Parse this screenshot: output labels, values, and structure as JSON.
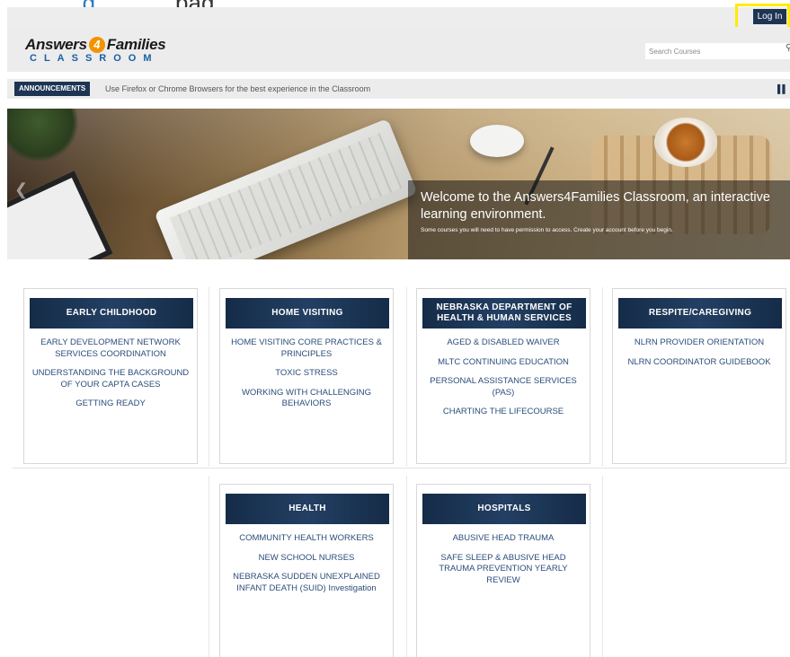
{
  "top_fragment": {
    "part1": "...g",
    "part2": "...pag"
  },
  "topbar": {
    "login_label": "Log In"
  },
  "header": {
    "logo_line1a": "Answers",
    "logo_four": "4",
    "logo_line1b": "Families",
    "logo_line2": "CLASSROOM",
    "search_placeholder": "Search Courses"
  },
  "announcements": {
    "label": "ANNOUNCEMENTS",
    "text": "Use Firefox or Chrome Browsers for the best experience in the Classroom"
  },
  "hero": {
    "title": "Welcome to the Answers4Families Classroom, an interactive learning environment.",
    "subtitle": "Some courses you will need to have permission to access.  Create your account before you begin."
  },
  "categories": [
    {
      "title": "EARLY CHILDHOOD",
      "courses": [
        "EARLY DEVELOPMENT NETWORK SERVICES COORDINATION",
        "UNDERSTANDING THE BACKGROUND OF YOUR CAPTA CASES",
        "GETTING READY"
      ]
    },
    {
      "title": "HOME VISITING",
      "courses": [
        "HOME VISITING CORE PRACTICES & PRINCIPLES",
        "TOXIC STRESS",
        "WORKING WITH CHALLENGING BEHAVIORS"
      ]
    },
    {
      "title": "NEBRASKA DEPARTMENT OF HEALTH & HUMAN SERVICES",
      "courses": [
        "AGED & DISABLED WAIVER",
        "MLTC CONTINUING EDUCATION",
        "PERSONAL ASSISTANCE SERVICES (PAS)",
        "CHARTING THE LIFECOURSE"
      ]
    },
    {
      "title": "RESPITE/CAREGIVING",
      "courses": [
        "NLRN PROVIDER ORIENTATION",
        "NLRN COORDINATOR GUIDEBOOK"
      ]
    },
    {
      "title": "HEALTH",
      "courses": [
        "COMMUNITY HEALTH WORKERS",
        "NEW SCHOOL NURSES",
        "NEBRASKA SUDDEN UNEXPLAINED INFANT DEATH (SUID) Investigation"
      ]
    },
    {
      "title": "HOSPITALS",
      "courses": [
        "ABUSIVE HEAD TRAUMA",
        "SAFE SLEEP & ABUSIVE HEAD TRAUMA PREVENTION YEARLY REVIEW"
      ]
    }
  ]
}
